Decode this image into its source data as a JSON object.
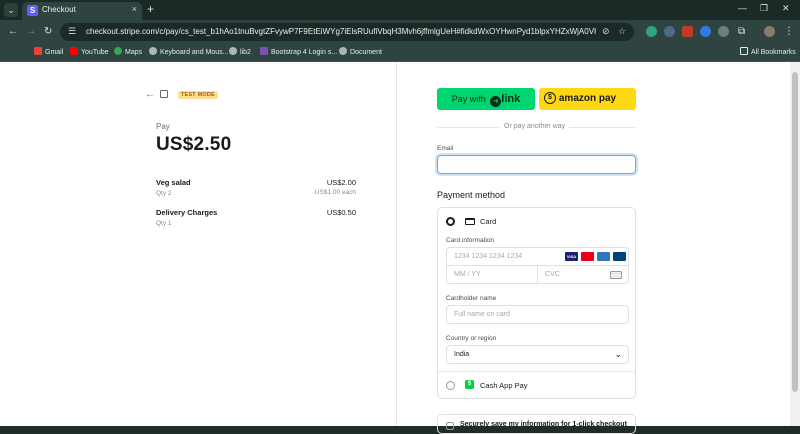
{
  "browser": {
    "tab_title": "Checkout",
    "tab_close": "×",
    "new_tab": "+",
    "url": "checkout.stripe.com/c/pay/cs_test_b1hAo1tnuBvgtZFvywP7F9EtEiWYg7iElsRUufiVbqH3Mvh6jffmlgUeH#fidkdWxOYHwnPyd1blpxYHZxWjA0VHFVUEdCf2Zobm",
    "bookmarks": [
      "Gmail",
      "YouTube",
      "Maps",
      "Keyboard and Mous...",
      "lib2",
      "Bootstrap 4 Login s...",
      "Document"
    ],
    "all_bookmarks": "All Bookmarks"
  },
  "summary": {
    "test_badge": "TEST MODE",
    "pay_label": "Pay",
    "amount": "US$2.50",
    "items": [
      {
        "name": "Veg salad",
        "qty": "Qty 2",
        "price": "US$2.00",
        "each": "US$1.00 each"
      },
      {
        "name": "Delivery Charges",
        "qty": "Qty 1",
        "price": "US$0.50"
      }
    ]
  },
  "payment": {
    "link_button_prefix": "Pay with",
    "link_button_word": "link",
    "amazon_button": "amazon pay",
    "or_text": "Or pay another way",
    "email_label": "Email",
    "email_value": "",
    "method_heading": "Payment method",
    "card_label": "Card",
    "card_info_label": "Card information",
    "card_number_placeholder": "1234 1234 1234 1234",
    "expiry_placeholder": "MM / YY",
    "cvc_placeholder": "CVC",
    "cardholder_label": "Cardholder name",
    "cardholder_placeholder": "Full name on card",
    "country_label": "Country or region",
    "country_value": "India",
    "cashapp_label": "Cash App Pay",
    "save_info_text": "Securely save my information for 1-click checkout"
  },
  "colors": {
    "link_green": "#00d66f",
    "amazon_yellow": "#ffd814",
    "test_badge_bg": "#ffde92",
    "stripe_purple": "#635bff"
  }
}
